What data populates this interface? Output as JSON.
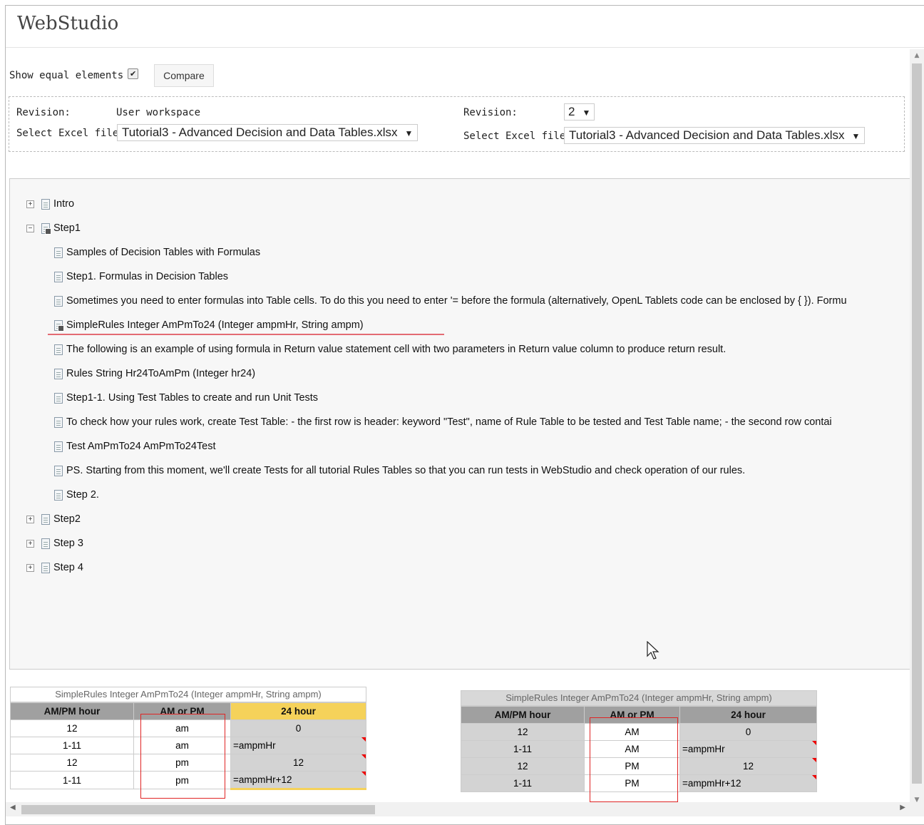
{
  "app": {
    "title": "WebStudio"
  },
  "toolbar": {
    "show_equal_label": "Show equal elements",
    "show_equal_checked": true,
    "compare_label": "Compare"
  },
  "left": {
    "revision_label": "Revision:",
    "revision_value": "User workspace",
    "file_label": "Select Excel file:",
    "file_value": "Tutorial3 - Advanced Decision and Data Tables.xlsx"
  },
  "right": {
    "revision_label": "Revision:",
    "revision_value": "2",
    "file_label": "Select Excel file:",
    "file_value": "Tutorial3 - Advanced Decision and Data Tables.xlsx"
  },
  "tree": {
    "nodes": [
      {
        "label": "Intro"
      },
      {
        "label": "Step1"
      },
      {
        "label": "Samples of Decision Tables with Formulas"
      },
      {
        "label": "Step1. Formulas in Decision Tables"
      },
      {
        "label": "Sometimes you need to enter formulas into Table cells. To do this you need to enter '= before the formula (alternatively, OpenL Tablets code can be enclosed by { }). Formu"
      },
      {
        "label": "SimpleRules Integer AmPmTo24 (Integer ampmHr, String ampm)"
      },
      {
        "label": "The following is an example of using formula in Return value statement cell with two parameters in Return value column to produce return result."
      },
      {
        "label": "Rules String Hr24ToAmPm (Integer hr24)"
      },
      {
        "label": "Step1-1. Using Test Tables to create and run Unit Tests"
      },
      {
        "label": "To check how your rules work, create Test Table: - the first row is header: keyword \"Test\", name of Rule Table to be tested and Test Table name; - the second row contai"
      },
      {
        "label": "Test AmPmTo24 AmPmTo24Test"
      },
      {
        "label": "PS. Starting from this moment, we'll create Tests for all tutorial Rules Tables so that you can run tests in WebStudio and check operation of our rules."
      },
      {
        "label": "Step 2."
      },
      {
        "label": "Step2"
      },
      {
        "label": "Step 3"
      },
      {
        "label": "Step 4"
      }
    ]
  },
  "left_table": {
    "caption": "SimpleRules Integer AmPmTo24 (Integer ampmHr, String ampm)",
    "headers": [
      "AM/PM hour",
      "AM or PM",
      "24 hour"
    ],
    "rows": [
      [
        "12",
        "am",
        "0"
      ],
      [
        "1-11",
        "am",
        "=ampmHr"
      ],
      [
        "12",
        "pm",
        "12"
      ],
      [
        "1-11",
        "pm",
        "=ampmHr+12"
      ]
    ]
  },
  "right_table": {
    "caption": "SimpleRules Integer AmPmTo24 (Integer ampmHr, String ampm)",
    "headers": [
      "AM/PM hour",
      "AM or PM",
      "24 hour"
    ],
    "rows": [
      [
        "12",
        "AM",
        "0"
      ],
      [
        "1-11",
        "AM",
        "=ampmHr"
      ],
      [
        "12",
        "PM",
        "12"
      ],
      [
        "1-11",
        "PM",
        "=ampmHr+12"
      ]
    ]
  },
  "colors": {
    "highlight_red": "#e02424",
    "underline": "#e36b73",
    "header_yellow": "#f5d25a",
    "header_gray": "#a0a0a0"
  }
}
